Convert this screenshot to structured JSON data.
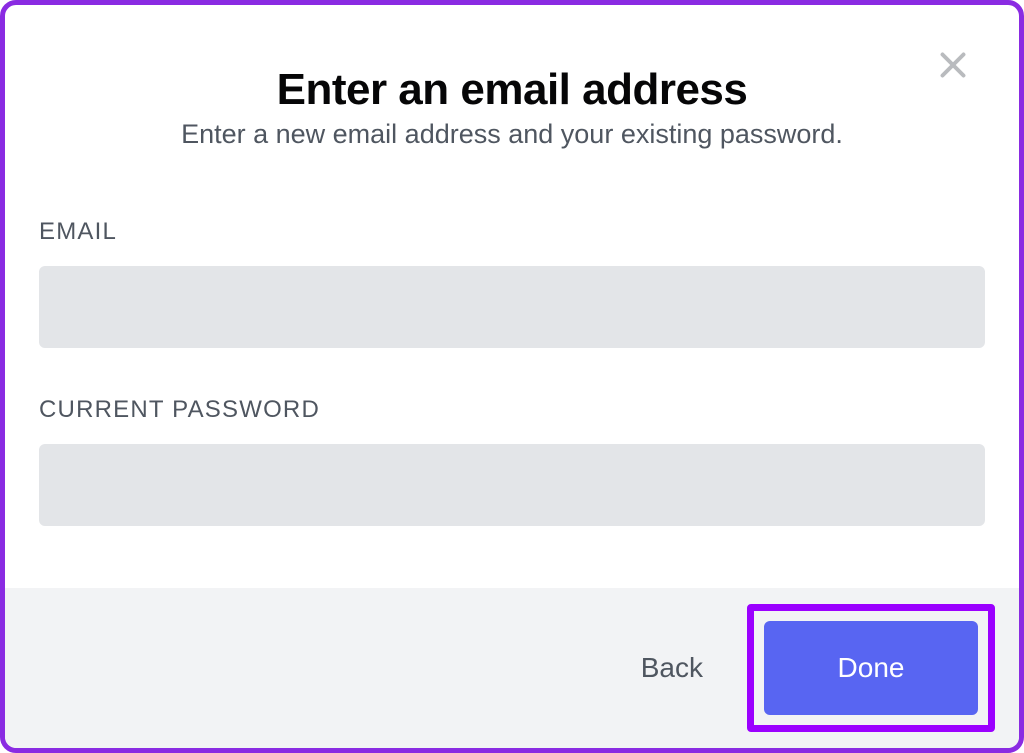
{
  "modal": {
    "title": "Enter an email address",
    "subtitle": "Enter a new email address and your existing password.",
    "fields": {
      "email": {
        "label": "EMAIL",
        "value": ""
      },
      "password": {
        "label": "CURRENT PASSWORD",
        "value": ""
      }
    },
    "buttons": {
      "back": "Back",
      "done": "Done"
    }
  }
}
